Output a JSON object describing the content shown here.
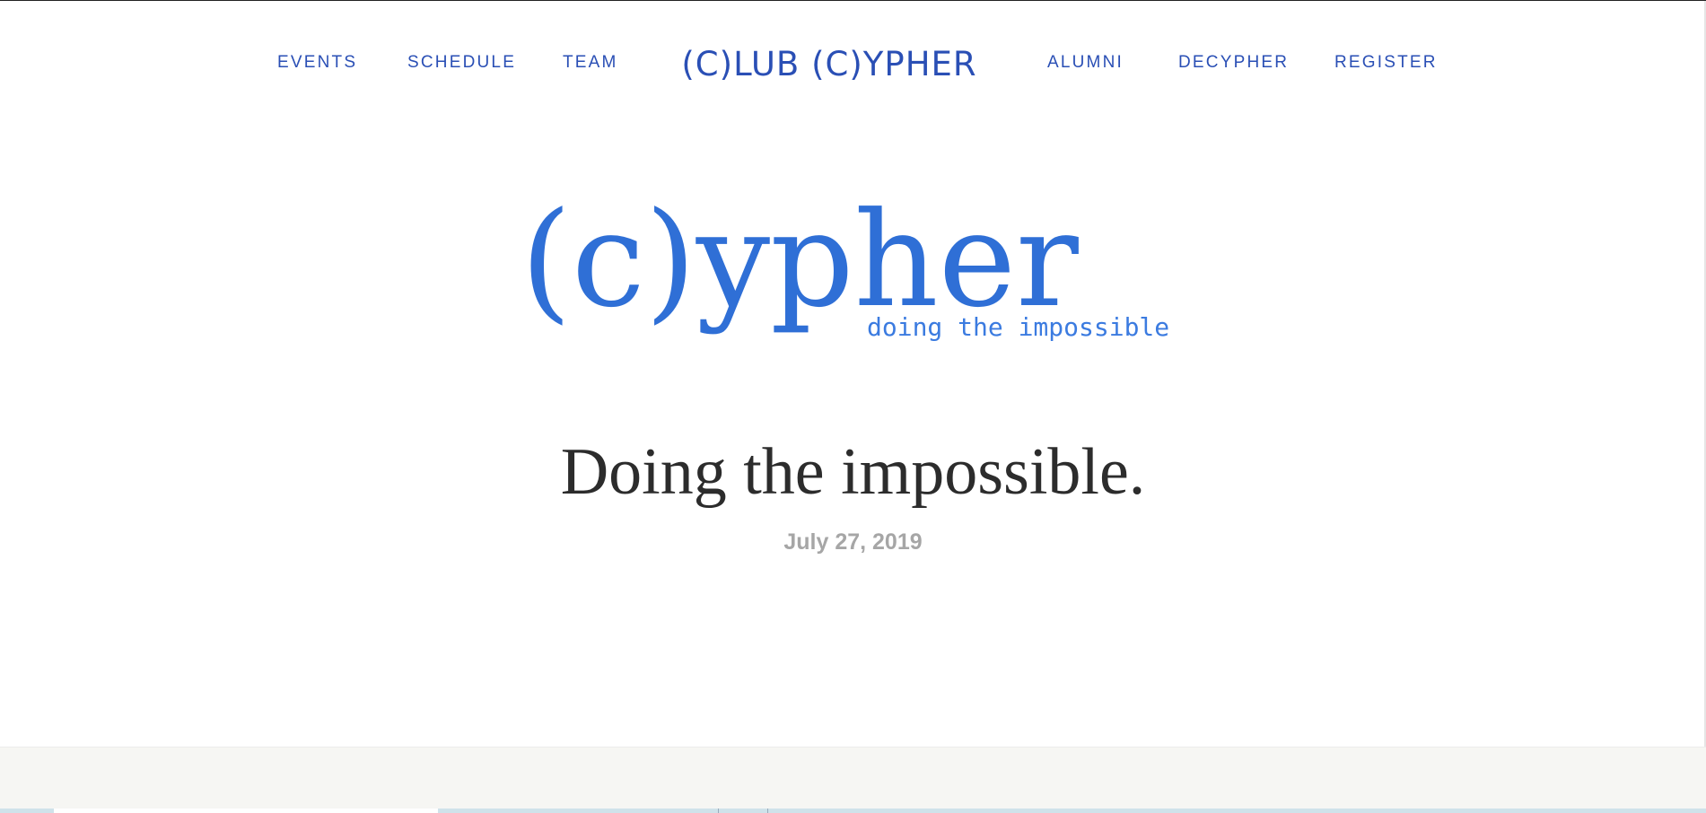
{
  "nav": {
    "left_items": [
      {
        "label": "EVENTS"
      },
      {
        "label": "SCHEDULE"
      },
      {
        "label": "TEAM"
      }
    ],
    "logo_text": "(C)LUB (C)YPHER",
    "right_items": [
      {
        "label": "ALUMNI"
      },
      {
        "label": "DECYPHER"
      },
      {
        "label": "REGISTER"
      }
    ]
  },
  "hero": {
    "logo_word": "(c)ypher",
    "tagline": "doing the impossible"
  },
  "post": {
    "title": "Doing the impossible.",
    "date": "July 27, 2019"
  },
  "colors": {
    "nav_text": "#2a4fb5",
    "logo_blue": "#2f6fd6",
    "title_text": "#2c2c2c",
    "date_text": "#a6a6a6",
    "footer_band": "#f6f6f3"
  }
}
